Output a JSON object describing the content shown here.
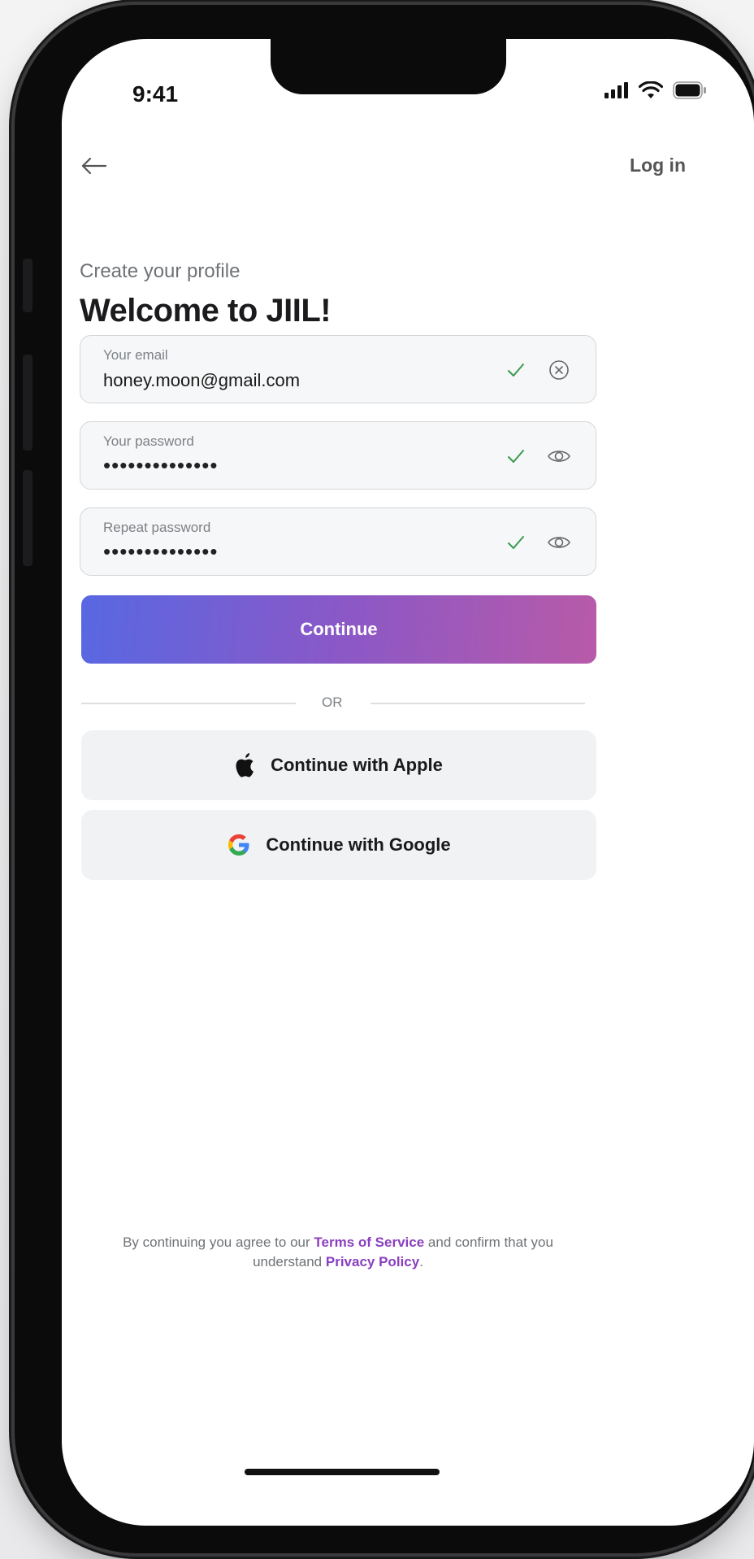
{
  "status_bar": {
    "time": "9:41"
  },
  "nav": {
    "back_icon": "arrow-left-icon",
    "login_label": "Log in"
  },
  "header": {
    "subtitle": "Create your profile",
    "title": "Welcome to JIIL!"
  },
  "form": {
    "email": {
      "label": "Your email",
      "value": "honey.moon@gmail.com",
      "valid": true,
      "action_icon": "clear-circle-icon"
    },
    "password": {
      "label": "Your password",
      "value": "••••••••••••••",
      "valid": true,
      "action_icon": "eye-icon"
    },
    "repeat_password": {
      "label": "Repeat password",
      "value": "••••••••••••••",
      "valid": true,
      "action_icon": "eye-icon"
    },
    "continue_label": "Continue"
  },
  "divider": {
    "text": "OR"
  },
  "social": {
    "apple_label": "Continue with Apple",
    "google_label": "Continue with Google"
  },
  "legal": {
    "prefix": "By continuing you agree to our",
    "terms_link": "Terms of Service",
    "middle": "and confirm that you understand",
    "privacy_link": "Privacy Policy",
    "suffix": "."
  },
  "colors": {
    "gradient_start": "#5868e2",
    "gradient_end": "#b85aa8",
    "link": "#8a3fbf",
    "check": "#3a9a4f"
  }
}
